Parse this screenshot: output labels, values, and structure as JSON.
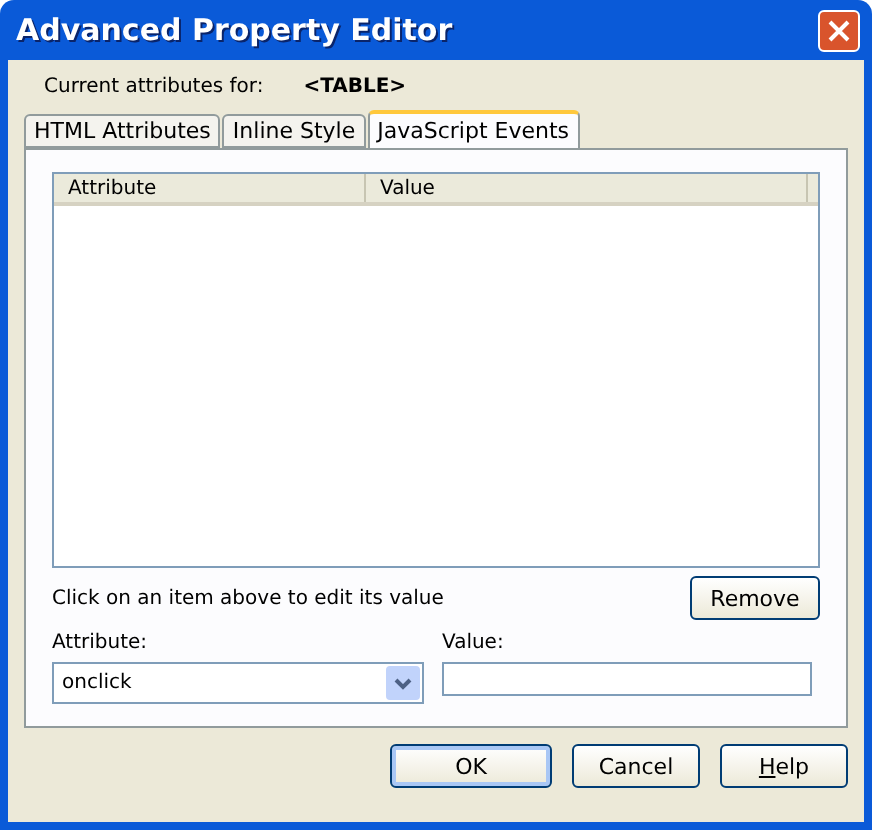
{
  "window": {
    "title": "Advanced Property Editor"
  },
  "current_attributes": {
    "label": "Current attributes for:",
    "element": "<TABLE>"
  },
  "tabs": [
    {
      "label": "HTML Attributes",
      "selected": false
    },
    {
      "label": "Inline Style",
      "selected": false
    },
    {
      "label": "JavaScript Events",
      "selected": true
    }
  ],
  "table": {
    "columns": [
      "Attribute",
      "Value"
    ]
  },
  "hint": "Click on an item above to edit its value",
  "remove_button": "Remove",
  "attribute_field": {
    "label": "Attribute:",
    "value": "onclick"
  },
  "value_field": {
    "label": "Value:"
  },
  "buttons": [
    {
      "label": "OK",
      "default": true
    },
    {
      "label": "Cancel",
      "default": false
    },
    {
      "label": "Help",
      "default": false,
      "underline_first": true
    }
  ]
}
